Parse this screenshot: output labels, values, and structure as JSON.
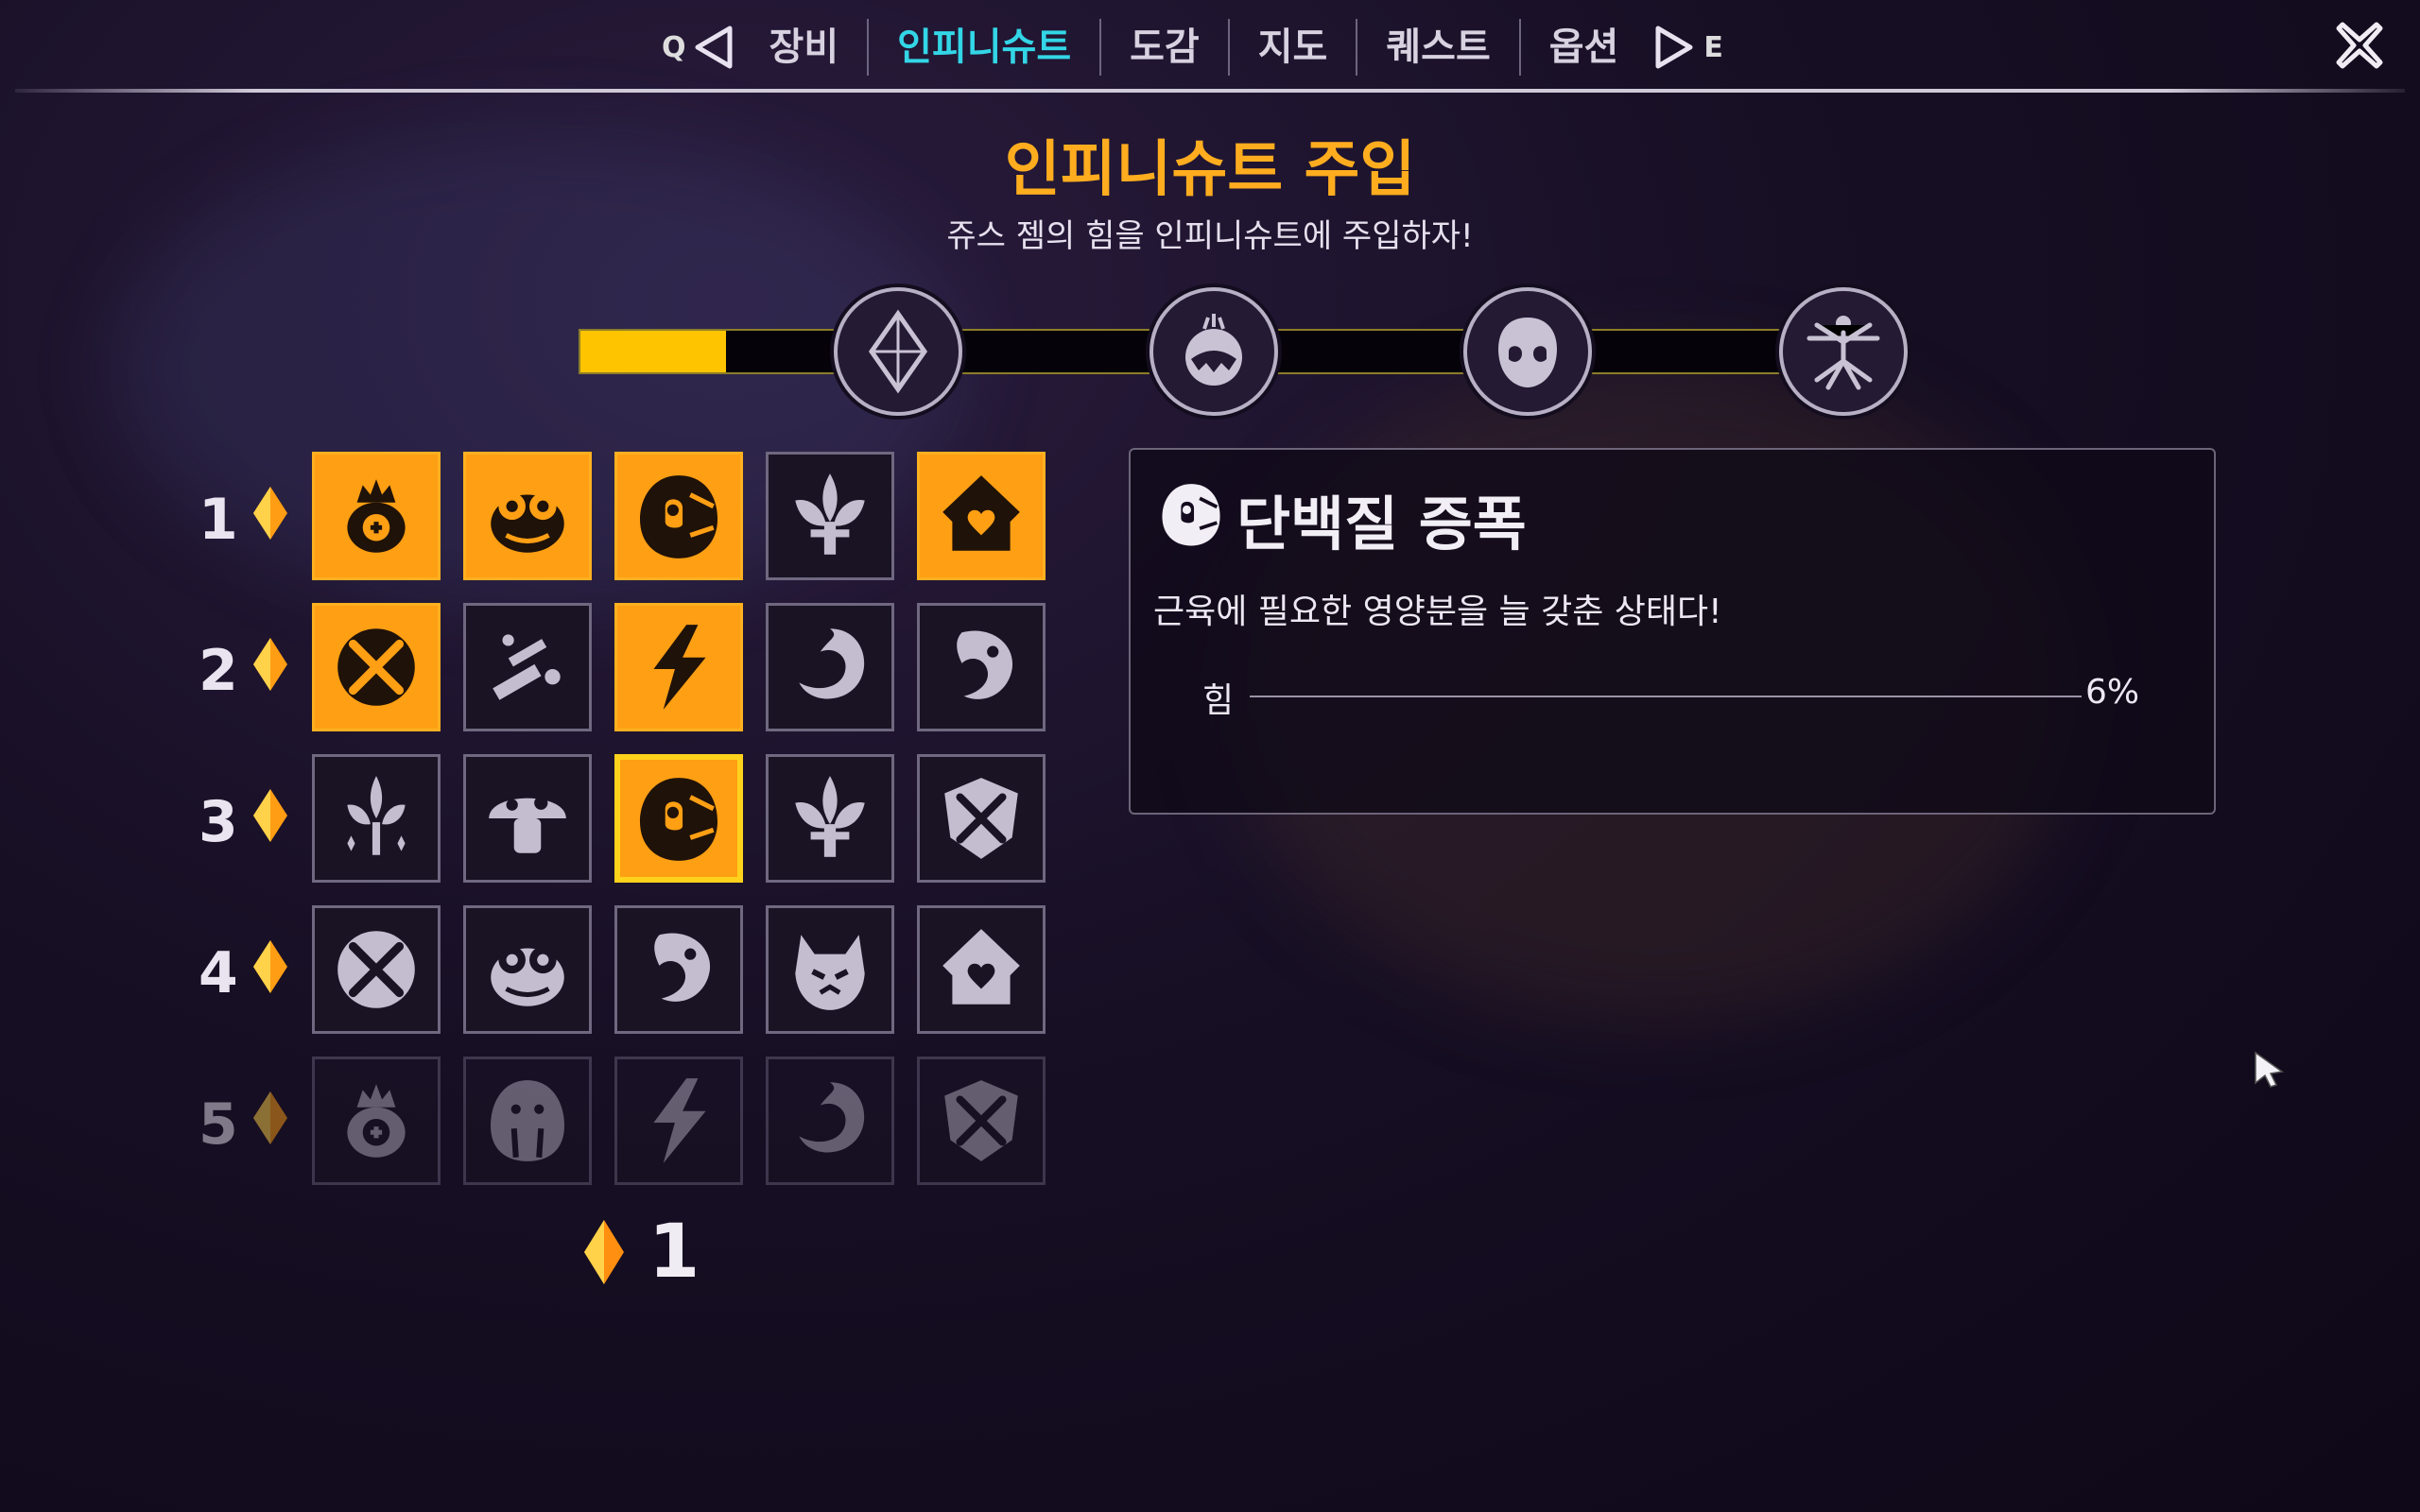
{
  "nav": {
    "prev_key": "Q",
    "next_key": "E",
    "tabs": [
      {
        "label": "장비",
        "active": false
      },
      {
        "label": "인피니슈트",
        "active": true
      },
      {
        "label": "도감",
        "active": false
      },
      {
        "label": "지도",
        "active": false
      },
      {
        "label": "퀘스트",
        "active": false
      },
      {
        "label": "옵션",
        "active": false
      }
    ]
  },
  "header": {
    "title": "인피니슈트 주입",
    "subtitle": "쥬스 젬의 힘을 인피니슈트에 주입하자!"
  },
  "progress": {
    "fill_fraction": 0.11,
    "nodes": [
      "gem-icon",
      "monster-icon",
      "mask-icon",
      "vitruvian-icon"
    ]
  },
  "grid": {
    "rows": [
      {
        "label": "1",
        "cells": [
          {
            "icon": "crown-cross-icon",
            "state": "active"
          },
          {
            "icon": "toad-icon",
            "state": "active"
          },
          {
            "icon": "helmet-icon",
            "state": "active"
          },
          {
            "icon": "fleur-icon",
            "state": "inactive"
          },
          {
            "icon": "heart-hood-icon",
            "state": "active"
          }
        ]
      },
      {
        "label": "2",
        "cells": [
          {
            "icon": "fork-spoon-icon",
            "state": "active"
          },
          {
            "icon": "debris-icon",
            "state": "inactive"
          },
          {
            "icon": "lightning-icon",
            "state": "active"
          },
          {
            "icon": "swirl-icon",
            "state": "inactive"
          },
          {
            "icon": "dragon-icon",
            "state": "inactive"
          }
        ]
      },
      {
        "label": "3",
        "cells": [
          {
            "icon": "fleur-sparkle-icon",
            "state": "inactive"
          },
          {
            "icon": "mushroom-icon",
            "state": "inactive"
          },
          {
            "icon": "helmet-icon",
            "state": "selected"
          },
          {
            "icon": "fleur-icon",
            "state": "inactive"
          },
          {
            "icon": "crossed-shield-icon",
            "state": "inactive"
          }
        ]
      },
      {
        "label": "4",
        "cells": [
          {
            "icon": "fork-spoon-icon",
            "state": "inactive"
          },
          {
            "icon": "toad-icon",
            "state": "inactive"
          },
          {
            "icon": "dragon-icon",
            "state": "inactive"
          },
          {
            "icon": "beast-face-icon",
            "state": "inactive"
          },
          {
            "icon": "heart-hood-icon",
            "state": "inactive"
          }
        ]
      },
      {
        "label": "5",
        "cells": [
          {
            "icon": "crown-cross-icon",
            "state": "locked"
          },
          {
            "icon": "walrus-icon",
            "state": "locked"
          },
          {
            "icon": "lightning-icon",
            "state": "locked"
          },
          {
            "icon": "swirl-icon",
            "state": "locked"
          },
          {
            "icon": "crossed-shield-icon",
            "state": "locked"
          }
        ]
      }
    ]
  },
  "points": {
    "value": "1"
  },
  "detail": {
    "icon": "helmet-icon",
    "title": "단백질 증폭",
    "description": "근육에 필요한 영양분을 늘 갖춘 상태다!",
    "stat_label": "힘",
    "stat_value": "6%"
  },
  "colors": {
    "accent_orange": "#ffad1f",
    "accent_cyan": "#33d6e6",
    "progress_yellow": "#ffc400"
  }
}
